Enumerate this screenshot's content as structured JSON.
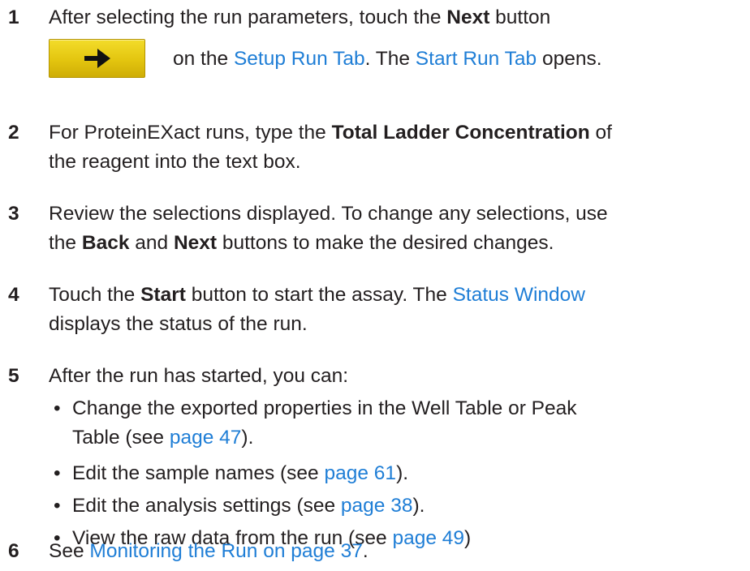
{
  "steps": [
    {
      "number": "1",
      "line1": {
        "t1": "After selecting the run parameters, touch the ",
        "b1": "Next",
        "t2": " button"
      },
      "line2": {
        "t1": " on the ",
        "l1": "Setup Run Tab",
        "t2": ". The ",
        "l2": "Start Run Tab",
        "t3": " opens."
      }
    },
    {
      "number": "2",
      "line1": {
        "t1": "For ProteinEXact runs, type the ",
        "b1": "Total Ladder Concentration",
        "t2": " of"
      },
      "line2": {
        "t1": "the reagent into the text box."
      }
    },
    {
      "number": "3",
      "line1": {
        "t1": "Review the selections displayed. To change any selections, use"
      },
      "line2": {
        "t1": "the ",
        "b1": "Back",
        "t2": " and ",
        "b2": "Next",
        "t3": " buttons to make the desired changes."
      }
    },
    {
      "number": "4",
      "line1": {
        "t1": "Touch the ",
        "b1": "Start",
        "t2": " button to start the assay. The ",
        "l1": "Status Window"
      },
      "line2": {
        "t1": "displays the status of the run."
      }
    },
    {
      "number": "5",
      "line1": {
        "t1": "After the run has started, you can:"
      },
      "bullets": [
        {
          "dot": "•",
          "t1": "Change the exported properties in the Well Table or Peak",
          "t2": "Table (see ",
          "l1": "page 47",
          "t3": ")."
        },
        {
          "dot": "•",
          "t1": "Edit the sample names (see ",
          "l1": "page 61",
          "t2": ")."
        },
        {
          "dot": "•",
          "t1": "Edit the analysis settings (see ",
          "l1": "page 38",
          "t2": ")."
        },
        {
          "dot": "•",
          "t1": "View the raw data from the run (see ",
          "l1": "page 49",
          "t2": ")"
        }
      ]
    },
    {
      "number": "6",
      "line1": {
        "t1": "See ",
        "l1": "Monitoring the Run on page 37",
        "t2": "."
      }
    }
  ],
  "colors": {
    "link": "#1f7ed6",
    "text": "#231f20",
    "button": "#e3c50f"
  },
  "icons": {
    "next_button_icon": "arrow-right-icon"
  }
}
